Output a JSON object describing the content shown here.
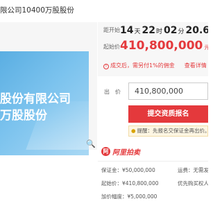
{
  "title": "限公司10400万股股份",
  "banner": {
    "line1": "股份有限公司",
    "line2": "万股股份"
  },
  "countdown": {
    "label": "距开始",
    "days": "14",
    "days_unit": "天",
    "hours": "22",
    "hours_unit": "时",
    "minutes": "02",
    "minutes_unit": "分",
    "seconds": "20.6"
  },
  "starting_price": {
    "label": "起始价",
    "value": "410,800,000",
    "unit": "元"
  },
  "notice": {
    "text": "成交后，需另付1%的佣金",
    "link": "查看详情",
    "arrow": "›",
    "icon": "info-icon"
  },
  "bid": {
    "label": "出　价",
    "value": "410,800,000"
  },
  "submit_label": "提交资质报名",
  "tip": {
    "icon": "lightbulb-icon",
    "text": "提醒：先报名交保证金再出价。"
  },
  "logo": {
    "mark": "阿",
    "text": "阿里拍卖",
    "icon": "alibaba-auction-logo"
  },
  "details": {
    "deposit": "保证金：¥50,000,000",
    "start_price": "起始价：¥410,800,000",
    "increment": "加价幅度：¥5,000,000",
    "shipping": "运费：无需发",
    "priority": "优先购买权人"
  },
  "colors": {
    "accent": "#e4393c",
    "banner": "#6fb8e8",
    "tip_bg": "#fdf6e3"
  }
}
